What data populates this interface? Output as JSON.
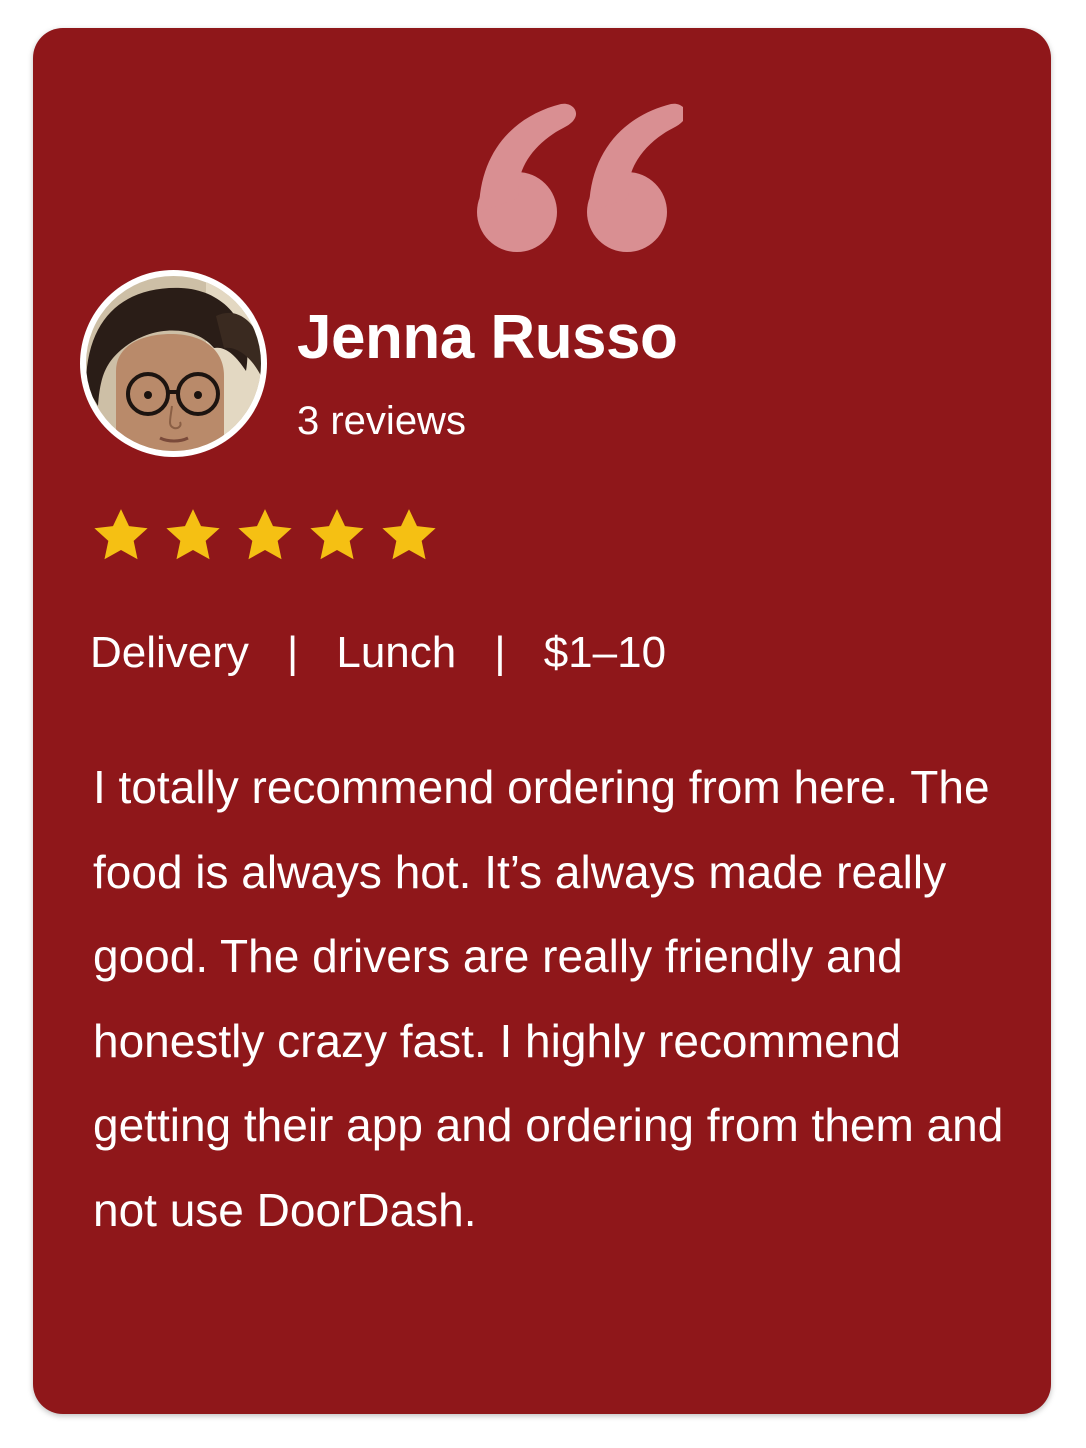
{
  "review": {
    "reviewer_name": "Jenna Russo",
    "review_count": "3 reviews",
    "rating": 5,
    "rating_max": 5,
    "tags": [
      "Delivery",
      "Lunch",
      "$1–10"
    ],
    "separator": "|",
    "text": "I totally recommend ordering from here. The food is always hot. It’s always made really good. The drivers are really friendly and honestly crazy fast. I highly recommend getting their app and ordering from them and not use DoorDash."
  },
  "icons": {
    "quote": "quote-icon",
    "star": "star-icon"
  },
  "colors": {
    "card_background": "#8f171a",
    "quote_mark": "#d98f92",
    "star": "#f5c013",
    "text": "#ffffff"
  }
}
